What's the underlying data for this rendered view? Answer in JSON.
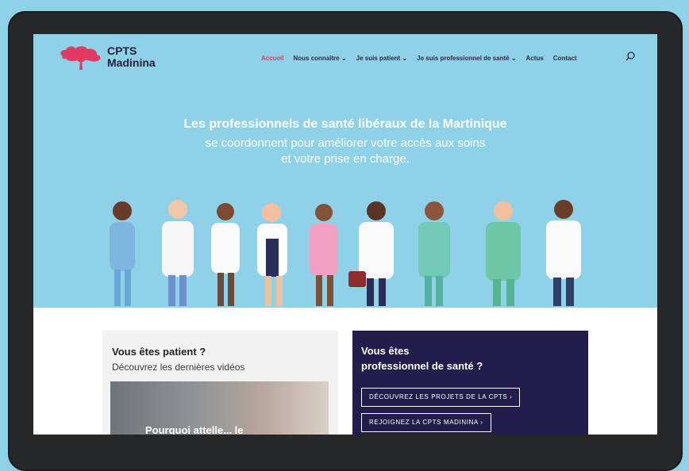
{
  "nav": {
    "logo_line1": "CPTS",
    "logo_line2": "Madinina",
    "items": [
      {
        "label": "Accueil",
        "active": true
      },
      {
        "label": "Nous connaître ⌄",
        "active": false
      },
      {
        "label": "Je suis patient ⌄",
        "active": false
      },
      {
        "label": "Je suis professionnel de santé ⌄",
        "active": false
      },
      {
        "label": "Actus",
        "active": false
      },
      {
        "label": "Contact",
        "active": false
      }
    ],
    "search_icon": "search-icon"
  },
  "hero": {
    "title": "Les professionnels de santé libéraux de la Martinique",
    "subtitle_line1": "se coordonnent pour améliorer votre accès aux soins",
    "subtitle_line2": "et votre prise en charge."
  },
  "patient_card": {
    "title": "Vous êtes patient ?",
    "subtitle": "Découvrez les dernières vidéos",
    "video_caption": "Pourquoi attelle... le"
  },
  "pro_card": {
    "title_line1": "Vous êtes",
    "title_line2": "professionnel de santé ?",
    "buttons": [
      {
        "label": "DÉCOUVREZ LES PROJETS DE LA CPTS ›"
      },
      {
        "label": "REJOIGNEZ LA CPTS MADININA ›"
      }
    ]
  },
  "colors": {
    "hero_bg": "#8fd1e7",
    "accent": "#d73e58",
    "navy": "#221d4a",
    "device": "#262728"
  }
}
